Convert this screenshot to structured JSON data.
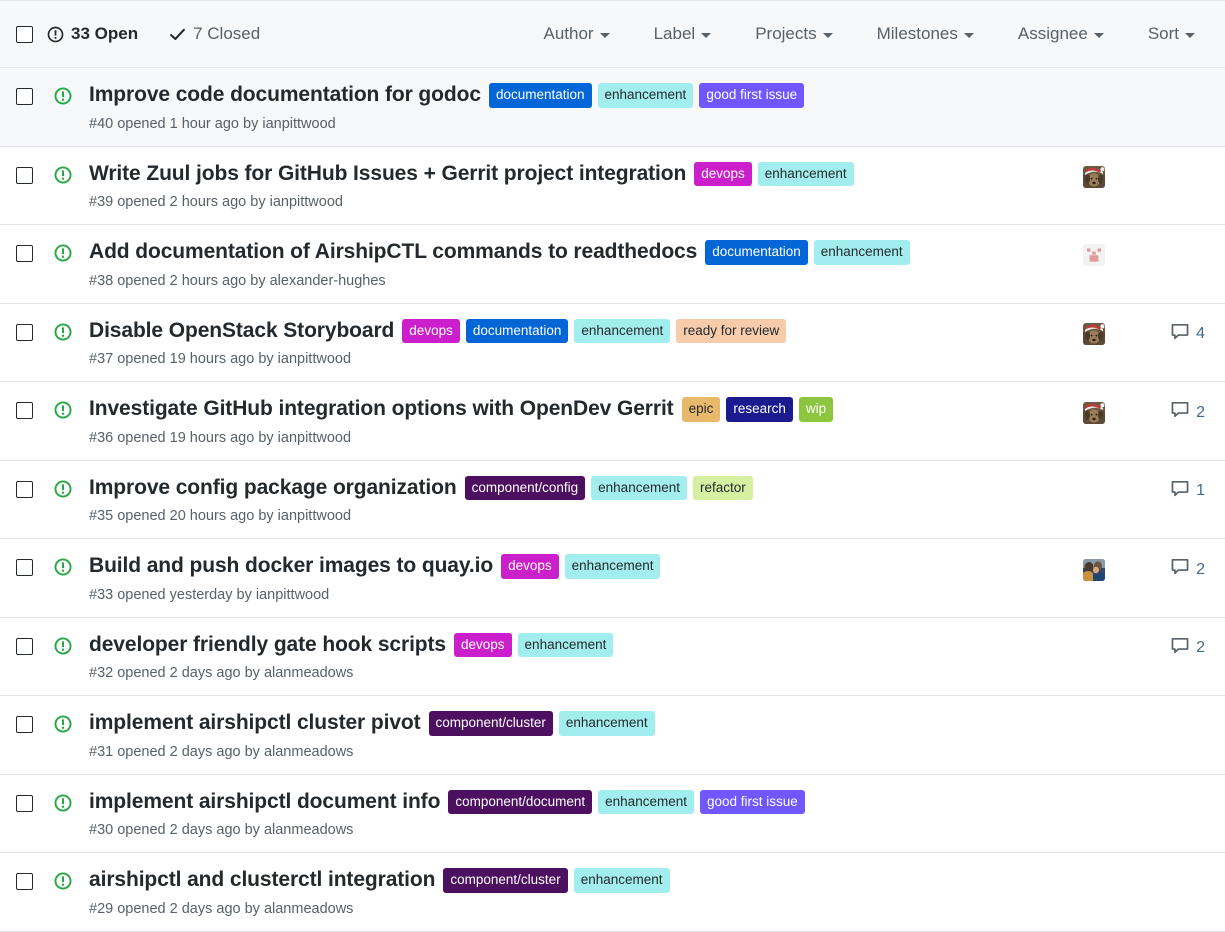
{
  "header": {
    "select_all_checkbox": "select-all",
    "open": {
      "icon": "issue-opened-icon",
      "label": "33 Open"
    },
    "closed": {
      "icon": "check-icon",
      "label": "7 Closed"
    },
    "filters": [
      {
        "label": "Author",
        "icon": "chevron-down-icon"
      },
      {
        "label": "Label",
        "icon": "chevron-down-icon"
      },
      {
        "label": "Projects",
        "icon": "chevron-down-icon"
      },
      {
        "label": "Milestones",
        "icon": "chevron-down-icon"
      },
      {
        "label": "Assignee",
        "icon": "chevron-down-icon"
      },
      {
        "label": "Sort",
        "icon": "chevron-down-icon"
      }
    ]
  },
  "label_colors": {
    "documentation": {
      "bg": "#0366d6",
      "fg": "#ffffff"
    },
    "enhancement": {
      "bg": "#a2eeef",
      "fg": "#24292e"
    },
    "good first issue": {
      "bg": "#7057ff",
      "fg": "#ffffff"
    },
    "devops": {
      "bg": "#cc1fcc",
      "fg": "#ffffff"
    },
    "ready for review": {
      "bg": "#f6ccaa",
      "fg": "#24292e"
    },
    "epic": {
      "bg": "#e8b96a",
      "fg": "#24292e"
    },
    "research": {
      "bg": "#1b1b8f",
      "fg": "#ffffff"
    },
    "wip": {
      "bg": "#8cc63f",
      "fg": "#ffffff"
    },
    "component/config": {
      "bg": "#4d1061",
      "fg": "#ffffff"
    },
    "component/cluster": {
      "bg": "#4d1061",
      "fg": "#ffffff"
    },
    "component/document": {
      "bg": "#4d1061",
      "fg": "#ffffff"
    },
    "refactor": {
      "bg": "#d4f0a0",
      "fg": "#24292e"
    }
  },
  "issues": [
    {
      "title": "Improve code documentation for godoc",
      "labels": [
        "documentation",
        "enhancement",
        "good first issue"
      ],
      "meta": "#40 opened 1 hour ago by ianpittwood",
      "state": "open",
      "avatar": null,
      "comments": null,
      "shaded": true
    },
    {
      "title": "Write Zuul jobs for GitHub Issues + Gerrit project integration",
      "labels": [
        "devops",
        "enhancement"
      ],
      "meta": "#39 opened 2 hours ago by ianpittwood",
      "state": "open",
      "avatar": "dog-santa-hat",
      "comments": null,
      "shaded": false
    },
    {
      "title": "Add documentation of AirshipCTL commands to readthedocs",
      "labels": [
        "documentation",
        "enhancement"
      ],
      "meta": "#38 opened 2 hours ago by alexander-hughes",
      "state": "open",
      "avatar": "pink-identicon",
      "comments": null,
      "shaded": false
    },
    {
      "title": "Disable OpenStack Storyboard",
      "labels": [
        "devops",
        "documentation",
        "enhancement",
        "ready for review"
      ],
      "meta": "#37 opened 19 hours ago by ianpittwood",
      "state": "open",
      "avatar": "dog-santa-hat",
      "comments": "4",
      "shaded": false
    },
    {
      "title": "Investigate GitHub integration options with OpenDev Gerrit",
      "labels": [
        "epic",
        "research",
        "wip"
      ],
      "meta": "#36 opened 19 hours ago by ianpittwood",
      "state": "open",
      "avatar": "dog-santa-hat",
      "comments": "2",
      "shaded": false
    },
    {
      "title": "Improve config package organization",
      "labels": [
        "component/config",
        "enhancement",
        "refactor"
      ],
      "meta": "#35 opened 20 hours ago by ianpittwood",
      "state": "open",
      "avatar": null,
      "comments": "1",
      "shaded": false
    },
    {
      "title": "Build and push docker images to quay.io",
      "labels": [
        "devops",
        "enhancement"
      ],
      "meta": "#33 opened yesterday by ianpittwood",
      "state": "open",
      "avatar": "photo-portrait",
      "comments": "2",
      "shaded": false
    },
    {
      "title": "developer friendly gate hook scripts",
      "labels": [
        "devops",
        "enhancement"
      ],
      "meta": "#32 opened 2 days ago by alanmeadows",
      "state": "open",
      "avatar": null,
      "comments": "2",
      "shaded": false
    },
    {
      "title": "implement airshipctl cluster pivot",
      "labels": [
        "component/cluster",
        "enhancement"
      ],
      "meta": "#31 opened 2 days ago by alanmeadows",
      "state": "open",
      "avatar": null,
      "comments": null,
      "shaded": false
    },
    {
      "title": "implement airshipctl document info",
      "labels": [
        "component/document",
        "enhancement",
        "good first issue"
      ],
      "meta": "#30 opened 2 days ago by alanmeadows",
      "state": "open",
      "avatar": null,
      "comments": null,
      "shaded": false
    },
    {
      "title": "airshipctl and clusterctl integration",
      "labels": [
        "component/cluster",
        "enhancement"
      ],
      "meta": "#29 opened 2 days ago by alanmeadows",
      "state": "open",
      "avatar": null,
      "comments": null,
      "shaded": false
    }
  ]
}
